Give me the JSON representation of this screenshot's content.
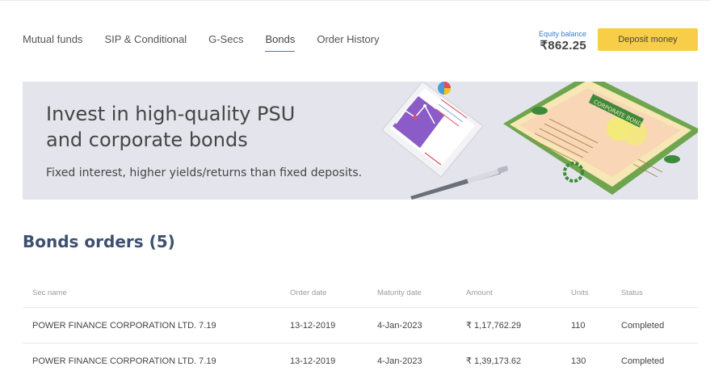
{
  "nav": {
    "tabs": [
      {
        "label": "Mutual funds",
        "active": false
      },
      {
        "label": "SIP & Conditional",
        "active": false
      },
      {
        "label": "G-Secs",
        "active": false
      },
      {
        "label": "Bonds",
        "active": true
      },
      {
        "label": "Order History",
        "active": false
      }
    ]
  },
  "balance": {
    "label": "Equity balance",
    "value": "₹862.25"
  },
  "deposit_button": "Deposit money",
  "banner": {
    "title_line1": "Invest in high-quality PSU",
    "title_line2": "and corporate bonds",
    "subtitle": "Fixed interest, higher yields/returns than fixed deposits.",
    "certificate_label": "CORPORATE BOND"
  },
  "section": {
    "title": "Bonds orders (5)"
  },
  "table": {
    "headers": [
      "Sec name",
      "Order date",
      "Maturity date",
      "Amount",
      "Units",
      "Status"
    ],
    "rows": [
      [
        "POWER FINANCE CORPORATION LTD. 7.19",
        "13-12-2019",
        "4-Jan-2023",
        "₹ 1,17,762.29",
        "110",
        "Completed"
      ],
      [
        "POWER FINANCE CORPORATION LTD. 7.19",
        "13-12-2019",
        "4-Jan-2023",
        "₹ 1,39,173.62",
        "130",
        "Completed"
      ]
    ]
  },
  "colors": {
    "accent": "#387ed1",
    "deposit": "#f8cd47",
    "banner_bg": "#e4e5ec",
    "section_title": "#3d5070"
  }
}
